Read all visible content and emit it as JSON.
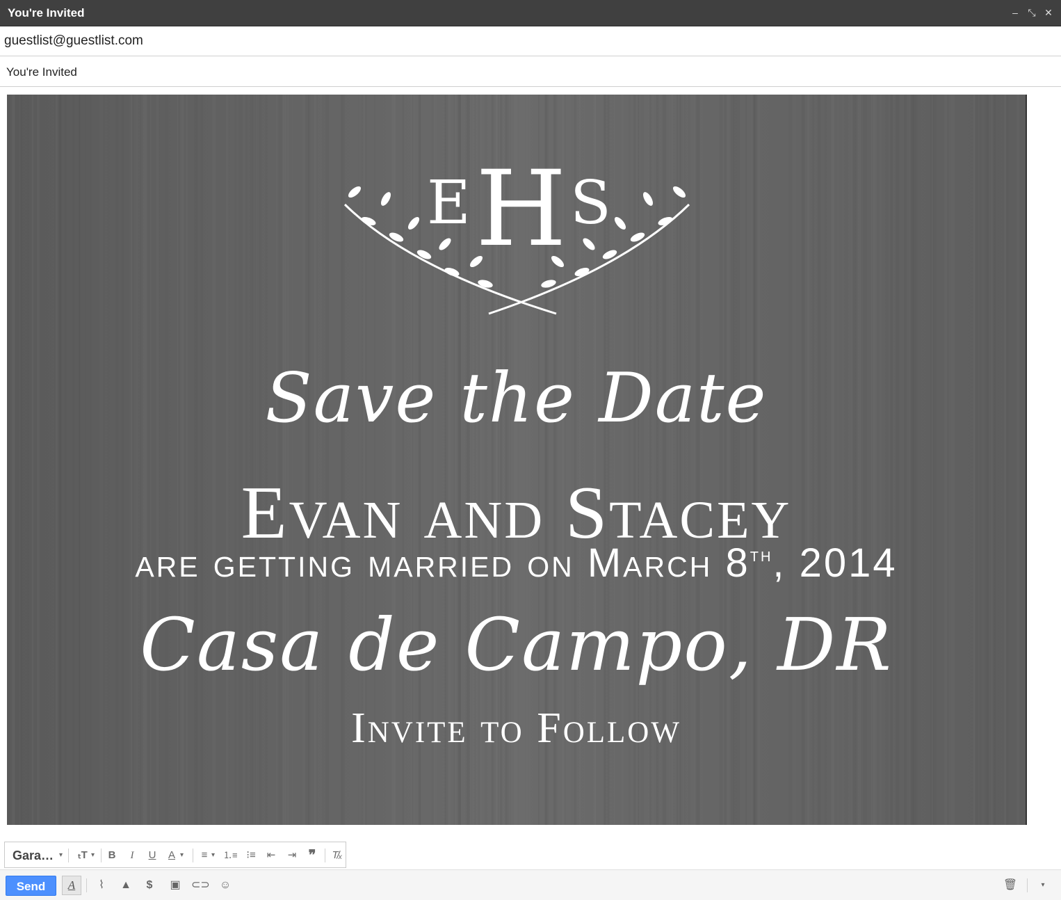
{
  "window": {
    "title": "You're Invited",
    "controls": {
      "minimize": "–",
      "popout": "⤡",
      "close": "✕"
    }
  },
  "to": {
    "value": "guestlist@guestlist.com"
  },
  "subject": {
    "value": "You're Invited"
  },
  "invite": {
    "monogram": {
      "left": "E",
      "center": "H",
      "right": "S"
    },
    "save_the_date": "Save the Date",
    "names": "Evan and Stacey",
    "married_line": "are getting married on March 8",
    "married_suffix": "th",
    "married_year": ", 2014",
    "place": "Casa de Campo, DR",
    "follow": "Invite to Follow",
    "background_color": "#616161"
  },
  "format_toolbar": {
    "font_label": "Gara…",
    "icons": [
      "font-size-icon",
      "bold-icon",
      "italic-icon",
      "underline-icon",
      "text-color-icon",
      "align-icon",
      "numbered-list-icon",
      "bulleted-list-icon",
      "indent-less-icon",
      "indent-more-icon",
      "quote-icon",
      "remove-formatting-icon"
    ]
  },
  "bottom_toolbar": {
    "send_label": "Send",
    "accent_color": "#4d90fe"
  }
}
